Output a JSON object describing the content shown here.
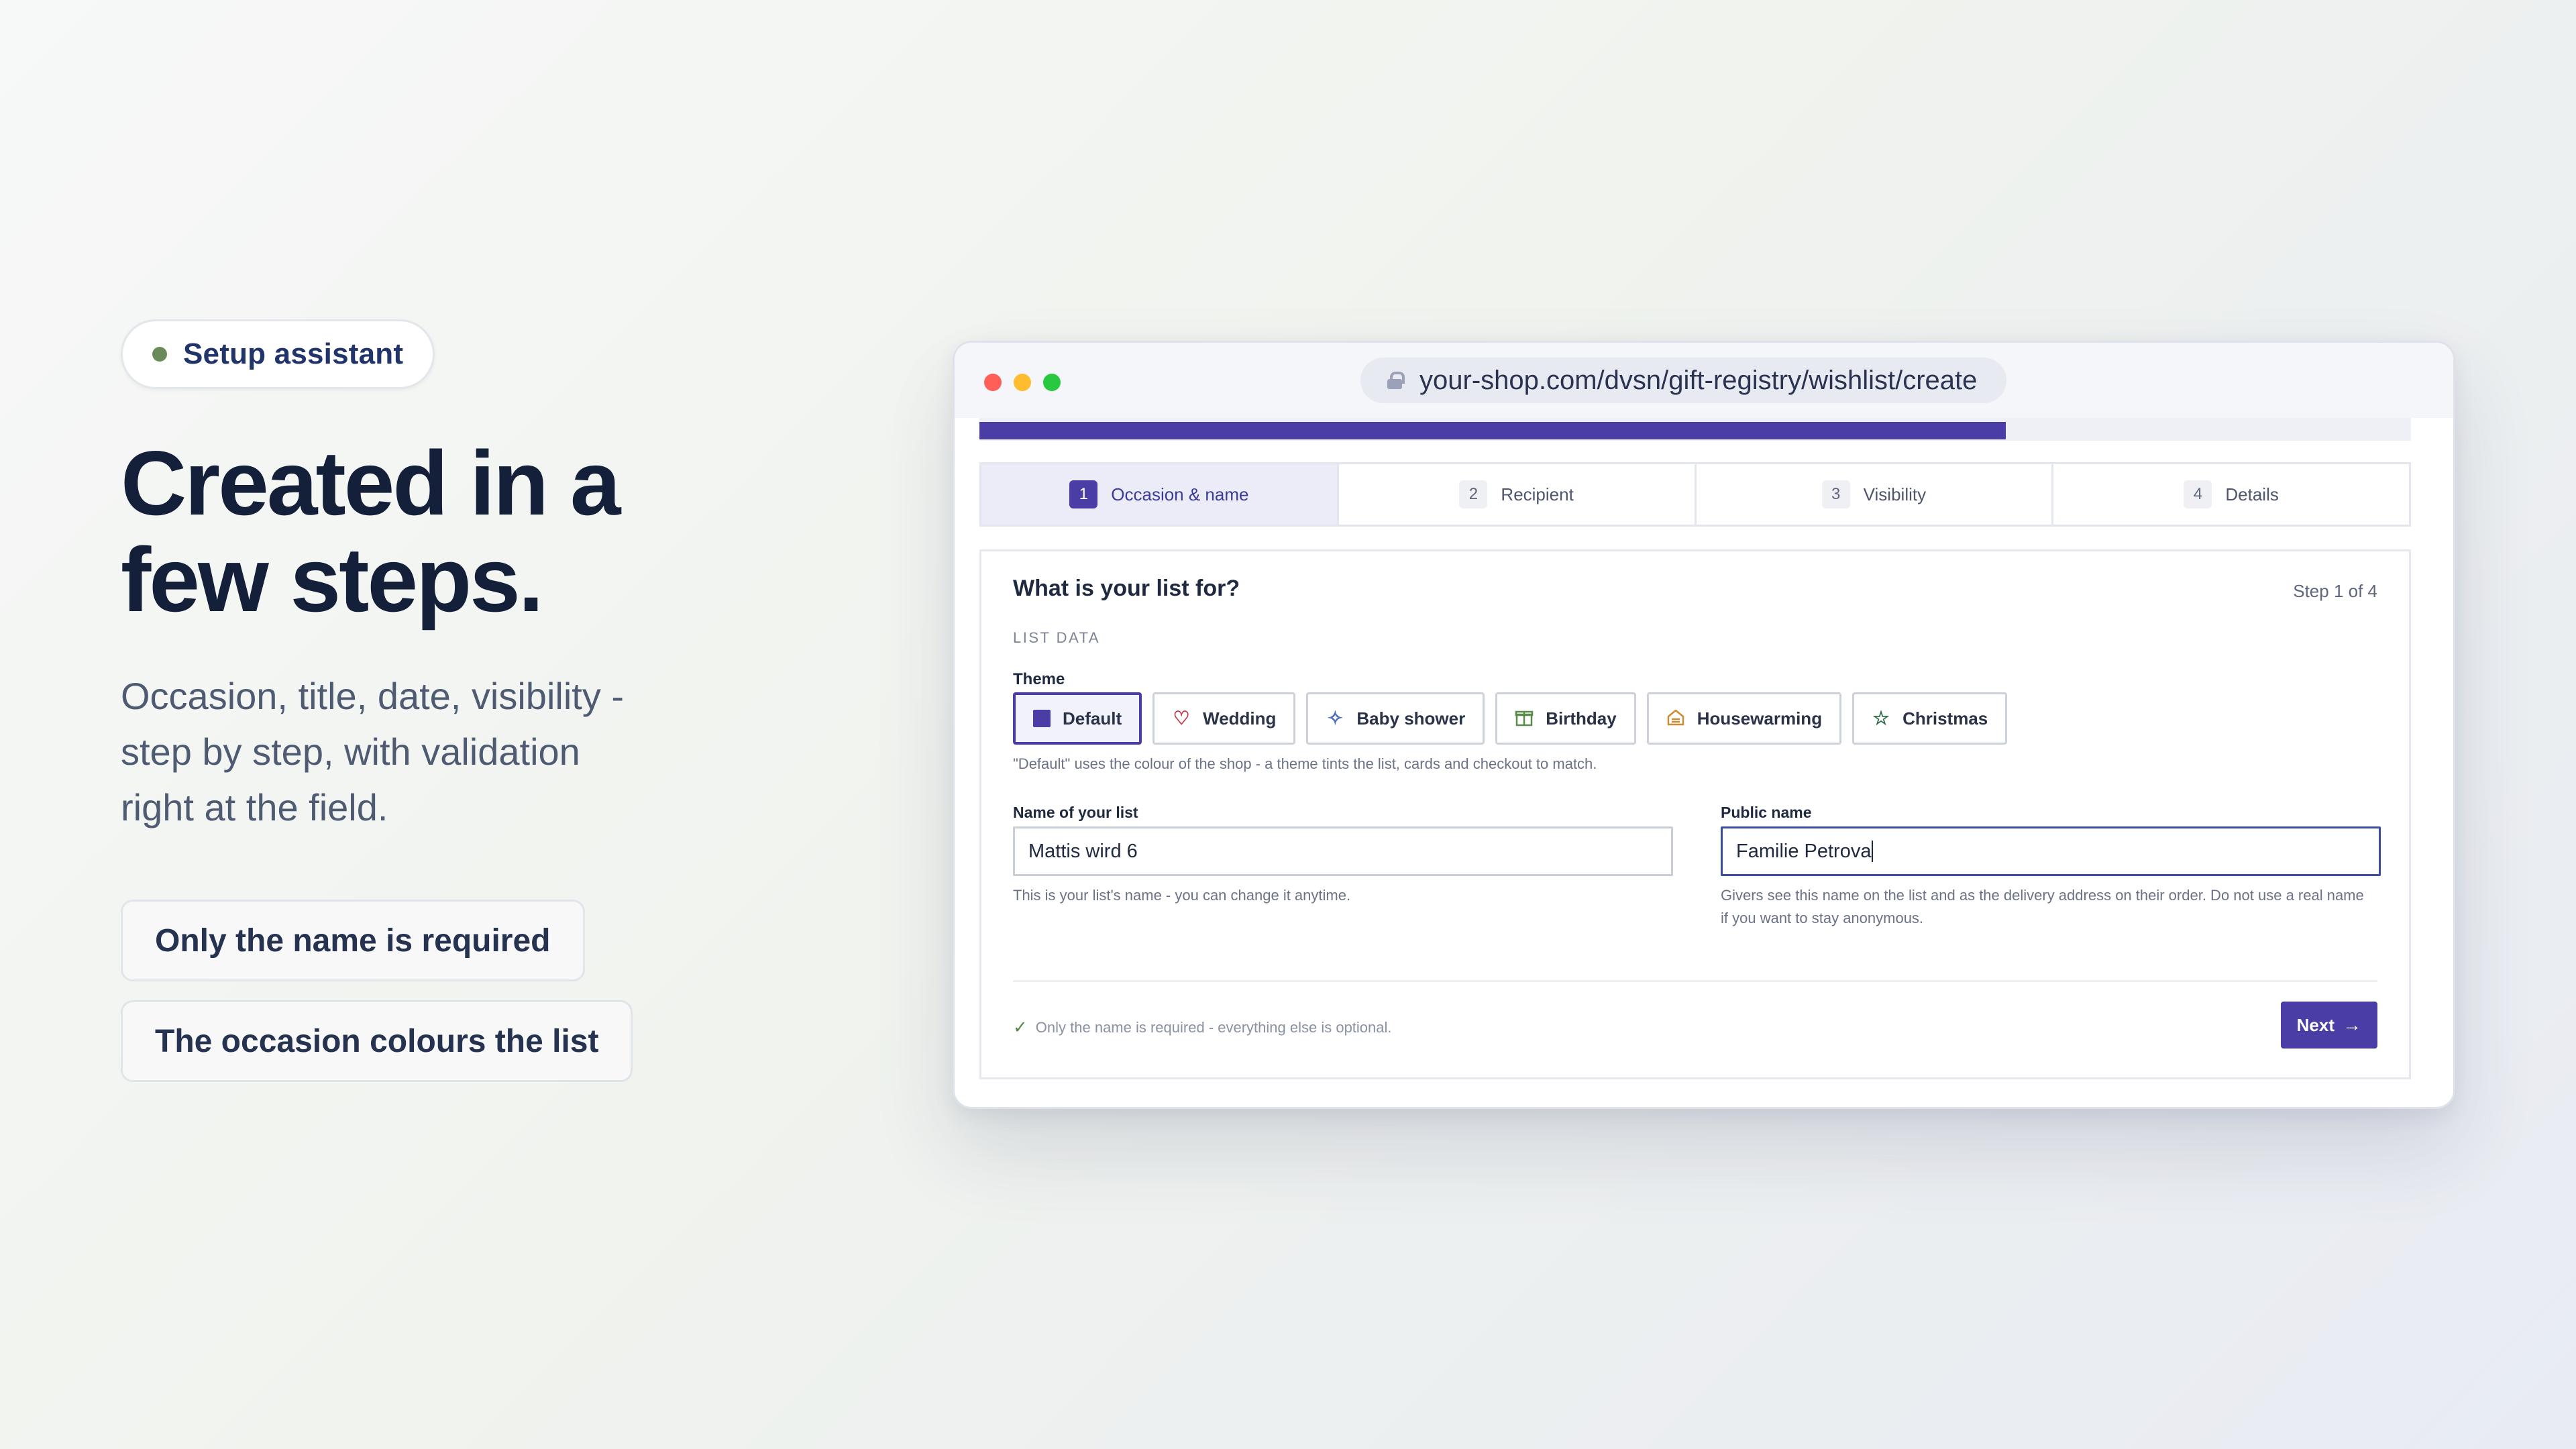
{
  "hero": {
    "badge": "Setup assistant",
    "headline_line1": "Created in a",
    "headline_line2": "few steps.",
    "subtext": "Occasion, title, date, visibility - step by step, with validation right at the field.",
    "tags": [
      "Only the name is required",
      "The occasion colours the list"
    ]
  },
  "browser": {
    "url": "your-shop.com/dvsn/gift-registry/wishlist/create"
  },
  "wizard": {
    "progress_fraction": 0.717,
    "steps": [
      {
        "num": "1",
        "label": "Occasion & name"
      },
      {
        "num": "2",
        "label": "Recipient"
      },
      {
        "num": "3",
        "label": "Visibility"
      },
      {
        "num": "4",
        "label": "Details"
      }
    ],
    "active_step": 1,
    "card_title": "What is your list for?",
    "step_indicator": "Step 1 of 4",
    "section_label": "LIST DATA",
    "theme_label": "Theme",
    "themes": [
      {
        "label": "Default",
        "icon": "square-icon"
      },
      {
        "label": "Wedding",
        "icon": "heart-icon"
      },
      {
        "label": "Baby shower",
        "icon": "sparkle-icon"
      },
      {
        "label": "Birthday",
        "icon": "gift-icon"
      },
      {
        "label": "Housewarming",
        "icon": "house-icon"
      },
      {
        "label": "Christmas",
        "icon": "star-icon"
      }
    ],
    "selected_theme": "Default",
    "theme_hint": "\"Default\" uses the colour of the shop - a theme tints the list, cards and checkout to match.",
    "list_name_label": "Name of your list",
    "list_name_value": "Mattis wird 6",
    "list_name_hint": "This is your list's name - you can change it anytime.",
    "public_name_label": "Public name",
    "public_name_value": "Familie Petrova",
    "public_name_hint": "Givers see this name on the list and as the delivery address on their order. Do not use a real name if you want to stay anonymous.",
    "footer_note": "Only the name is required - everything else is optional.",
    "next_label": "Next"
  },
  "colors": {
    "accent": "#4a3ea6",
    "headline": "#141f3a",
    "badge_dot": "#6a8a5a"
  }
}
